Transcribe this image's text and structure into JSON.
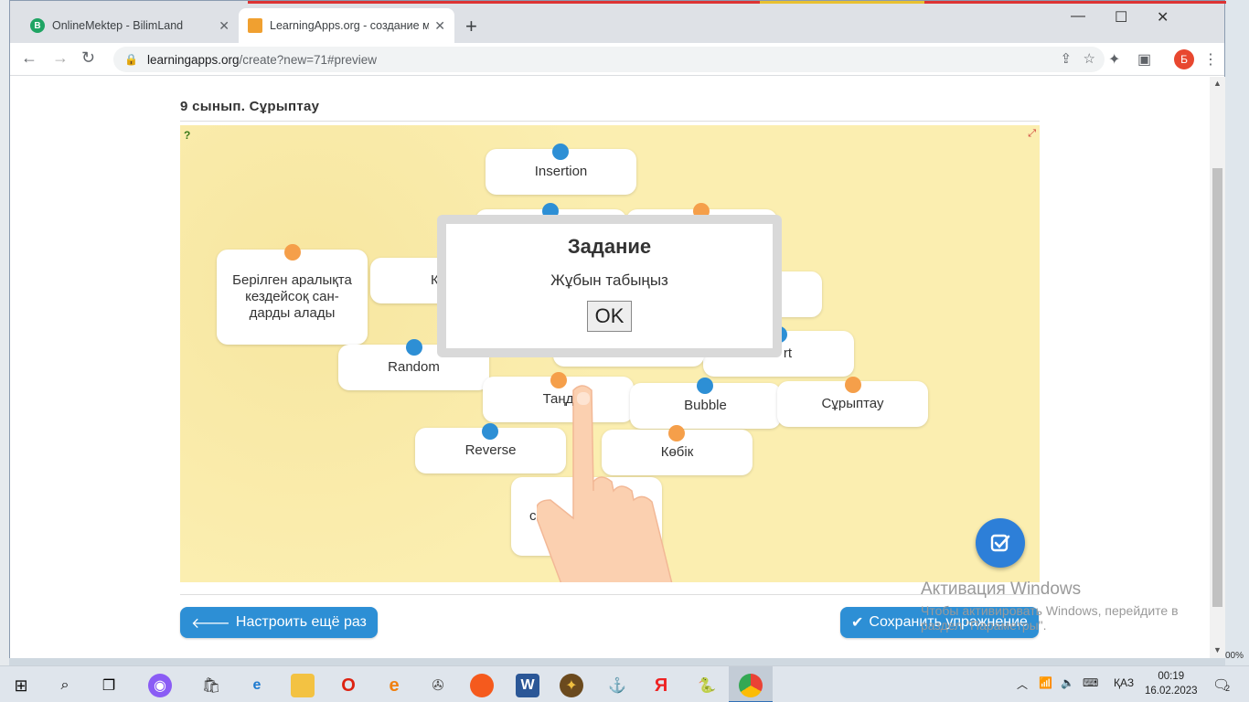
{
  "browser": {
    "tabs": [
      {
        "title": "OnlineMektep - BilimLand",
        "favicon": "B",
        "color": "#1fa463",
        "icon": "bilimland-icon"
      },
      {
        "title": "LearningApps.org - создание му",
        "favicon": "",
        "color": "#f0a030",
        "icon": "learningapps-icon"
      }
    ],
    "new_tab": "+",
    "url_host": "learningapps.org",
    "url_path": "/create?new=71#preview",
    "profile_initial": "Б",
    "window_controls": {
      "minimize": "—",
      "maximize": "☐",
      "close": "✕"
    }
  },
  "page": {
    "title": "9 сынып. Сұрыптау"
  },
  "cards": [
    {
      "text": "Insertion",
      "pin": "blue"
    },
    {
      "text": "",
      "pin": "blue"
    },
    {
      "text": "",
      "pin": "orange"
    },
    {
      "text": "Берілген аралықта кездейсоқ сан-дарды алады",
      "pin": "orange"
    },
    {
      "text": "К",
      "pin": ""
    },
    {
      "text": "",
      "pin": ""
    },
    {
      "text": "rt",
      "pin": "blue"
    },
    {
      "text": "Random",
      "pin": "blue"
    },
    {
      "text": "Таңд",
      "pin": "orange"
    },
    {
      "text": "Bubble",
      "pin": "blue"
    },
    {
      "text": "Сұрыптау",
      "pin": "orange"
    },
    {
      "text": "Reverse",
      "pin": "blue"
    },
    {
      "text": "Көбік",
      "pin": "orange"
    },
    {
      "text": "са ра",
      "pin": ""
    }
  ],
  "modal": {
    "title": "Задание",
    "text": "Жұбын табыңыз",
    "ok_label": "OK"
  },
  "buttons": {
    "restart": "Настроить ещё раз",
    "save": "Сохранить упражнение"
  },
  "watermark": {
    "line1": "Активация Windows",
    "line2": "Чтобы активировать Windows, перейдите в раздел \"Параметры\"."
  },
  "taskbar": {
    "language": "ҚАЗ",
    "time": "00:19",
    "date": "16.02.2023",
    "notifications": "2",
    "zoom_hint": "00%"
  }
}
